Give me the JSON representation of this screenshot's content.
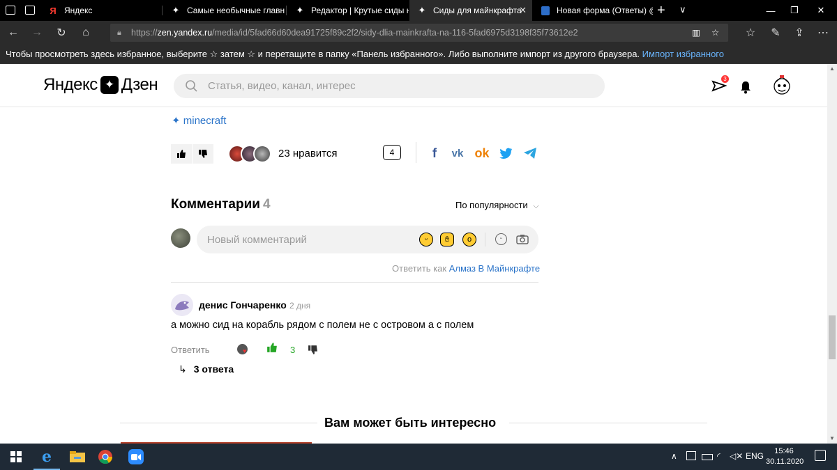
{
  "browser": {
    "tabs": [
      {
        "title": "Яндекс",
        "favicon": "yandex-favicon"
      },
      {
        "title": "Самые необычные главны",
        "favicon": "zen-favicon"
      },
      {
        "title": "Редактор | Крутые сиды на",
        "favicon": "zen-favicon"
      },
      {
        "title": "Сиды для майнкрафта",
        "favicon": "zen-favicon",
        "active": true
      },
      {
        "title": "Новая форма (Ответы) @ (",
        "favicon": "forms-favicon"
      }
    ],
    "url_host": "zen.yandex.ru",
    "url_path": "/media/id/5fad66d60dea91725f89c2f2/sidy-dlia-mainkrafta-na-116-5fad6975d3198f35f73612e2",
    "url_scheme": "https://",
    "favbar_text": "Чтобы просмотреть здесь избранное, выберите  ☆  затем ☆ и перетащите в папку «Панель избранного». Либо выполните импорт из другого браузера.",
    "favbar_link": "Импорт избранного"
  },
  "header": {
    "logo_left": "Яндекс",
    "logo_right": "Дзен",
    "search_placeholder": "Статья, видео, канал, интерес",
    "notif_badge": "3"
  },
  "article": {
    "tag": "minecraft",
    "likes_text": "23 нравится",
    "comments_count": "4"
  },
  "comments": {
    "title": "Комментарии",
    "count": "4",
    "sort_label": "По популярности",
    "input_placeholder": "Новый комментарий",
    "reply_as_prefix": "Ответить как",
    "reply_as_name": "Алмаз В Майнкрафте",
    "items": [
      {
        "author": "денис Гончаренко",
        "date": "2 дня",
        "text": "а можно сид на корабль рядом с полем не с островом а с полем",
        "reply_label": "Ответить",
        "likes": "3",
        "answers_label": "3 ответа"
      }
    ]
  },
  "suggestions": {
    "title": "Вам может быть интересно"
  },
  "taskbar": {
    "lang": "ENG",
    "time": "15:46",
    "date": "30.11.2020"
  },
  "colors": {
    "link": "#2b74c9",
    "like_green": "#25a625",
    "taskbar": "#1f2a36"
  }
}
